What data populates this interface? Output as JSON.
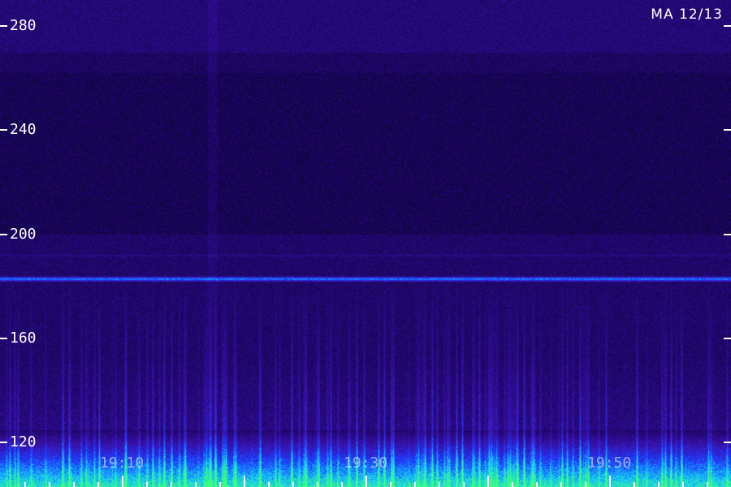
{
  "station_label": "MA 12/13",
  "chart_data": {
    "type": "heatmap",
    "title": "",
    "xlabel": "",
    "ylabel": "",
    "y_ticks": [
      280,
      240,
      200,
      160,
      120
    ],
    "y_tick_labels": [
      "280",
      "240",
      "200",
      "160",
      "120"
    ],
    "ylim": [
      103,
      290
    ],
    "x_tick_labels": [
      "19:10",
      "19:30",
      "19:50"
    ],
    "x_label_times_min": [
      10,
      30,
      50
    ],
    "xlim_min": [
      0,
      60
    ],
    "features": {
      "narrowband_line_y": 183,
      "faint_line_y": 192,
      "low_band_energy_below_y": 125
    },
    "colormap": [
      "#000000",
      "#1a0560",
      "#3a10a8",
      "#1f3cff",
      "#11c9ff",
      "#3dff7a"
    ]
  }
}
